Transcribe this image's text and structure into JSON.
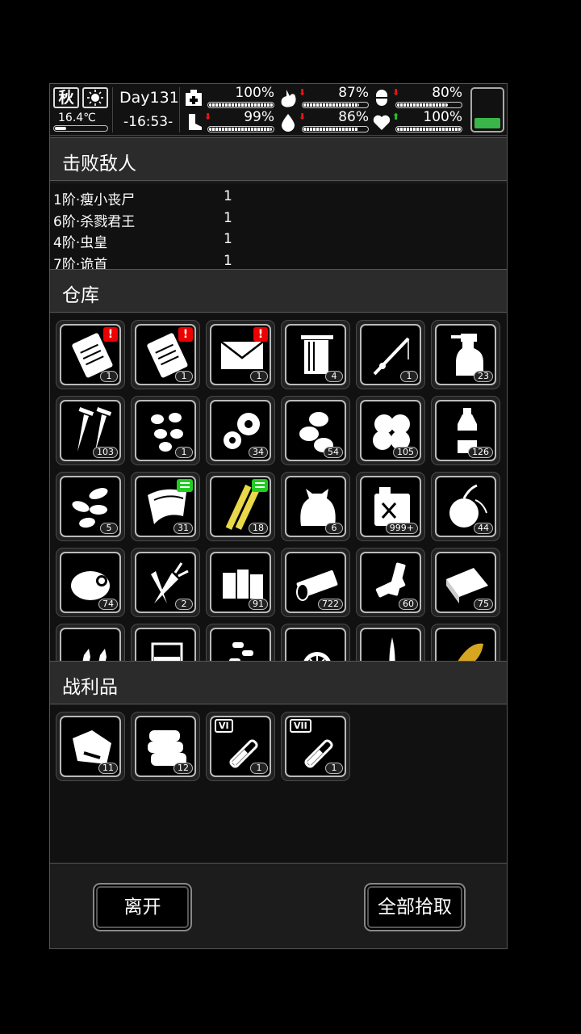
{
  "status": {
    "season": "秋",
    "temperature": "16.4℃",
    "day": "Day131",
    "time": "-16:53-",
    "stats": [
      {
        "icon": "medkit-icon",
        "value": "100%",
        "fill": 1.0,
        "trend": ""
      },
      {
        "icon": "stomach-icon",
        "value": "87%",
        "fill": 0.87,
        "trend": "down"
      },
      {
        "icon": "pill-icon",
        "value": "80%",
        "fill": 0.8,
        "trend": "down"
      },
      {
        "icon": "boot-icon",
        "value": "99%",
        "fill": 0.99,
        "trend": "down"
      },
      {
        "icon": "water-drop-icon",
        "value": "86%",
        "fill": 0.86,
        "trend": "down"
      },
      {
        "icon": "heart-icon",
        "value": "100%",
        "fill": 1.0,
        "trend": "up"
      }
    ],
    "battery_color": "#39b54a"
  },
  "defeated": {
    "title": "击败敌人",
    "enemies": [
      {
        "name": "1阶·瘦小丧尸",
        "count": "1"
      },
      {
        "name": "6阶·杀戮君王",
        "count": "1"
      },
      {
        "name": "4阶·虫皇",
        "count": "1"
      },
      {
        "name": "7阶·诡首",
        "count": "1"
      }
    ]
  },
  "warehouse": {
    "title": "仓库",
    "items": [
      {
        "icon": "clipboard-icon",
        "qty": "1",
        "badge": "red"
      },
      {
        "icon": "clipboard-icon",
        "qty": "1",
        "badge": "red"
      },
      {
        "icon": "envelope-icon",
        "qty": "1",
        "badge": "red"
      },
      {
        "icon": "towel-icon",
        "qty": "4",
        "badge": ""
      },
      {
        "icon": "fishing-rod-icon",
        "qty": "1",
        "badge": ""
      },
      {
        "icon": "spray-bottle-icon",
        "qty": "23",
        "badge": ""
      },
      {
        "icon": "screws-icon",
        "qty": "103",
        "badge": ""
      },
      {
        "icon": "beans-icon",
        "qty": "1",
        "badge": ""
      },
      {
        "icon": "gears-icon",
        "qty": "34",
        "badge": ""
      },
      {
        "icon": "nuts-icon",
        "qty": "54",
        "badge": ""
      },
      {
        "icon": "cotton-icon",
        "qty": "105",
        "badge": ""
      },
      {
        "icon": "bottle-icon",
        "qty": "126",
        "badge": ""
      },
      {
        "icon": "seeds-icon",
        "qty": "5",
        "badge": ""
      },
      {
        "icon": "cloth-icon",
        "qty": "31",
        "badge": "green"
      },
      {
        "icon": "bamboo-icon",
        "qty": "18",
        "badge": "green"
      },
      {
        "icon": "sack-icon",
        "qty": "6",
        "badge": ""
      },
      {
        "icon": "jerrycan-icon",
        "qty": "999+",
        "badge": ""
      },
      {
        "icon": "onion-icon",
        "qty": "44",
        "badge": ""
      },
      {
        "icon": "meat-icon",
        "qty": "74",
        "badge": ""
      },
      {
        "icon": "carrot-icon",
        "qty": "2",
        "badge": ""
      },
      {
        "icon": "planks-icon",
        "qty": "91",
        "badge": ""
      },
      {
        "icon": "log-icon",
        "qty": "722",
        "badge": ""
      },
      {
        "icon": "batteries-icon",
        "qty": "60",
        "badge": ""
      },
      {
        "icon": "cloth-sheet-icon",
        "qty": "75",
        "badge": ""
      },
      {
        "icon": "bullets-icon",
        "qty": "",
        "badge": ""
      },
      {
        "icon": "measuring-cup-icon",
        "qty": "",
        "badge": ""
      },
      {
        "icon": "pills-icon",
        "qty": "",
        "badge": ""
      },
      {
        "icon": "citrus-slice-icon",
        "qty": "",
        "badge": ""
      },
      {
        "icon": "blade-icon",
        "qty": "",
        "badge": ""
      },
      {
        "icon": "leaf-icon",
        "qty": "",
        "badge": ""
      }
    ]
  },
  "loot": {
    "title": "战利品",
    "items": [
      {
        "icon": "raw-meat-icon",
        "qty": "11"
      },
      {
        "icon": "fabric-stack-icon",
        "qty": "12"
      },
      {
        "icon": "test-tube-icon",
        "qty": "1",
        "tag": "VI"
      },
      {
        "icon": "test-tube-icon",
        "qty": "1",
        "tag": "VII"
      }
    ]
  },
  "buttons": {
    "leave": "离开",
    "take_all": "全部拾取"
  }
}
